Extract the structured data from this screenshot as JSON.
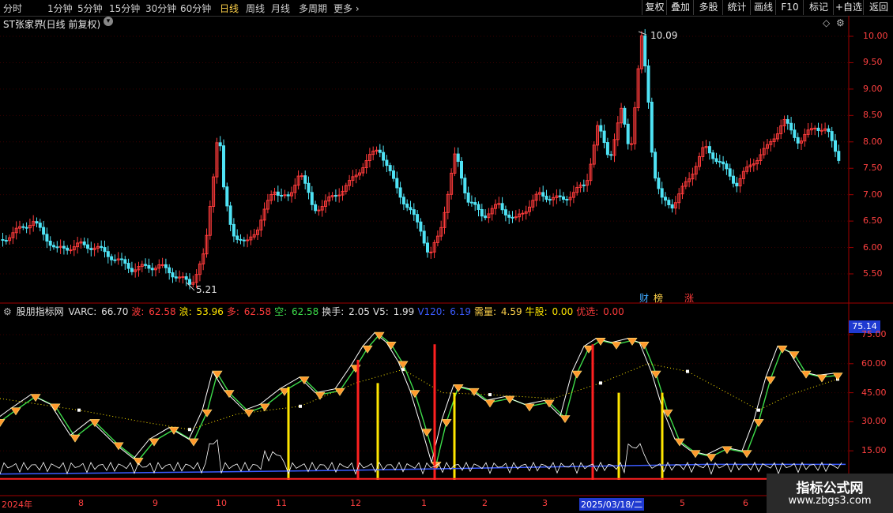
{
  "toolbar": {
    "periods": [
      {
        "label": "分时",
        "active": false
      },
      {
        "label": "1分钟",
        "active": false
      },
      {
        "label": "5分钟",
        "active": false
      },
      {
        "label": "15分钟",
        "active": false
      },
      {
        "label": "30分钟",
        "active": false
      },
      {
        "label": "60分钟",
        "active": false
      },
      {
        "label": "日线",
        "active": true
      },
      {
        "label": "周线",
        "active": false
      },
      {
        "label": "月线",
        "active": false
      },
      {
        "label": "多周期",
        "active": false
      }
    ],
    "more_label": "更多",
    "buttons": [
      "复权",
      "叠加",
      "多股",
      "统计",
      "画线",
      "F10",
      "标记",
      "+自选",
      "返回"
    ]
  },
  "main": {
    "title": "ST张家界",
    "adjust_mode": "(日线 前复权)",
    "high_label": "10.09",
    "low_label": "5.21",
    "price_ticks": [
      "10.00",
      "9.50",
      "9.00",
      "8.50",
      "8.00",
      "7.50",
      "7.00",
      "6.50",
      "6.00",
      "5.50"
    ],
    "markers": [
      {
        "text": "财",
        "color": "#3fa9ff"
      },
      {
        "text": "榜",
        "color": "#ffd24a"
      },
      {
        "text": "涨",
        "color": "#ff3b3b"
      }
    ]
  },
  "indicator": {
    "name": "股朋指标网",
    "fields": [
      {
        "label": "VARC:",
        "value": "66.70",
        "color": "#e0e0e0"
      },
      {
        "label": "波:",
        "value": "62.58",
        "color": "#ff3b3b"
      },
      {
        "label": "浪:",
        "value": "53.96",
        "color": "#ffe600"
      },
      {
        "label": "多:",
        "value": "62.58",
        "color": "#ff3b3b"
      },
      {
        "label": "空:",
        "value": "62.58",
        "color": "#3ddc4a"
      },
      {
        "label": "换手:",
        "value": "2.05",
        "color": "#e0e0e0"
      },
      {
        "label": "V5:",
        "value": "1.99",
        "color": "#e0e0e0"
      },
      {
        "label": "V120:",
        "value": "6.19",
        "color": "#3b5bff"
      },
      {
        "label": "需量:",
        "value": "4.59",
        "color": "#ffd24a"
      },
      {
        "label": "牛股:",
        "value": "0.00",
        "color": "#ffe600"
      },
      {
        "label": "优选:",
        "value": "0.00",
        "color": "#ff3b3b"
      }
    ],
    "current_value": "75.14",
    "ticks": [
      "75.00",
      "60.00",
      "45.00",
      "30.00",
      "15.00"
    ]
  },
  "xaxis": {
    "labels": [
      "2024年",
      "8",
      "9",
      "10",
      "11",
      "12",
      "1",
      "2",
      "3",
      "2025/03/18/二",
      "5",
      "6"
    ]
  },
  "watermark": {
    "title": "指标公式网",
    "url": "www.zbgs3.com"
  },
  "colors": {
    "up": "#ff3b3b",
    "down": "#4fe3f5",
    "axis": "#a00000"
  }
}
